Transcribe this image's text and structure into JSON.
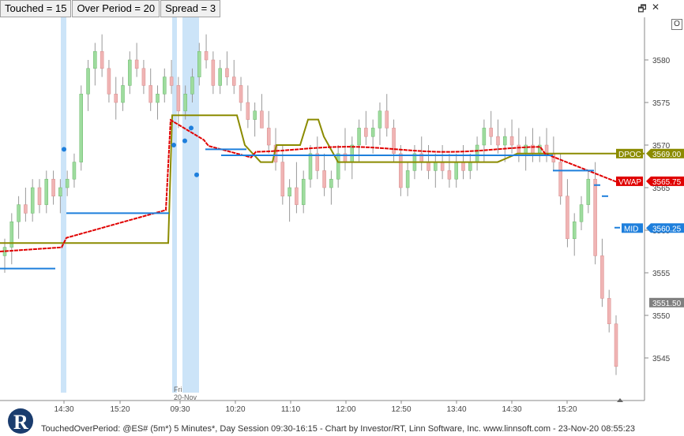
{
  "toolbar": {
    "params": [
      {
        "label": "Touched = 15"
      },
      {
        "label": "Over Period = 20"
      },
      {
        "label": "Spread = 3"
      }
    ]
  },
  "window_buttons": {
    "restore": "🗗",
    "close": "✕",
    "o_button": "O"
  },
  "footer": {
    "text": "TouchedOverPeriod: @ES# (5m*) 5 Minutes*, Day Session 09:30-16:15 - Chart by Investor/RT, Linn Software, Inc. www.linnsoft.com - 23-Nov-20 08:55:23"
  },
  "colors": {
    "vwap": "#e00000",
    "mid": "#1e7fdc",
    "dpoc": "#8b8b00",
    "highlight": "#cce4f8",
    "dot": "#1e7fdc",
    "candle_up": "#9edc9e",
    "candle_down": "#f0b4b4",
    "last_price": "#808080"
  },
  "chart_data": {
    "type": "candlestick",
    "y_ticks": [
      3545,
      3550,
      3555,
      3560,
      3565,
      3570,
      3575,
      3580
    ],
    "ylim": [
      3540,
      3585
    ],
    "x_labels": [
      "14:30",
      "15:20",
      "09:30",
      "10:20",
      "11:10",
      "12:00",
      "12:50",
      "13:40",
      "14:30",
      "15:20"
    ],
    "session_label": [
      "Fri",
      "20-Nov"
    ],
    "candles": [
      [
        3557,
        3559,
        3555,
        3558
      ],
      [
        3558,
        3562,
        3556,
        3561
      ],
      [
        3561,
        3564,
        3559,
        3563
      ],
      [
        3563,
        3565,
        3561,
        3562
      ],
      [
        3562,
        3566,
        3561,
        3565
      ],
      [
        3565,
        3566,
        3562,
        3563
      ],
      [
        3563,
        3567,
        3562,
        3566
      ],
      [
        3566,
        3567,
        3563,
        3564
      ],
      [
        3564,
        3566,
        3562,
        3565
      ],
      [
        3565,
        3567,
        3564,
        3566
      ],
      [
        3566,
        3569,
        3565,
        3568
      ],
      [
        3568,
        3577,
        3567,
        3576
      ],
      [
        3576,
        3580,
        3574,
        3579
      ],
      [
        3579,
        3582,
        3577,
        3581
      ],
      [
        3581,
        3583,
        3578,
        3579
      ],
      [
        3579,
        3580,
        3575,
        3576
      ],
      [
        3576,
        3578,
        3573,
        3575
      ],
      [
        3575,
        3578,
        3574,
        3577
      ],
      [
        3577,
        3581,
        3576,
        3580
      ],
      [
        3580,
        3582,
        3578,
        3579
      ],
      [
        3579,
        3580,
        3576,
        3577
      ],
      [
        3577,
        3579,
        3574,
        3575
      ],
      [
        3575,
        3577,
        3573,
        3576
      ],
      [
        3576,
        3579,
        3575,
        3578
      ],
      [
        3578,
        3580,
        3576,
        3577
      ],
      [
        3577,
        3578,
        3572,
        3574
      ],
      [
        3574,
        3577,
        3573,
        3576
      ],
      [
        3576,
        3579,
        3575,
        3578
      ],
      [
        3578,
        3582,
        3577,
        3581
      ],
      [
        3581,
        3583,
        3579,
        3580
      ],
      [
        3580,
        3581,
        3576,
        3577
      ],
      [
        3577,
        3580,
        3576,
        3579
      ],
      [
        3579,
        3581,
        3577,
        3578
      ],
      [
        3578,
        3580,
        3576,
        3577
      ],
      [
        3577,
        3578,
        3574,
        3575
      ],
      [
        3575,
        3577,
        3572,
        3573
      ],
      [
        3573,
        3575,
        3571,
        3574
      ],
      [
        3574,
        3576,
        3572,
        3572
      ],
      [
        3572,
        3574,
        3569,
        3570
      ],
      [
        3570,
        3572,
        3567,
        3568
      ],
      [
        3568,
        3570,
        3563,
        3564
      ],
      [
        3564,
        3566,
        3561,
        3565
      ],
      [
        3565,
        3568,
        3562,
        3563
      ],
      [
        3563,
        3567,
        3562,
        3566
      ],
      [
        3566,
        3570,
        3565,
        3569
      ],
      [
        3569,
        3571,
        3566,
        3567
      ],
      [
        3567,
        3569,
        3564,
        3565
      ],
      [
        3565,
        3567,
        3563,
        3566
      ],
      [
        3566,
        3570,
        3565,
        3569
      ],
      [
        3569,
        3572,
        3567,
        3568
      ],
      [
        3568,
        3571,
        3566,
        3570
      ],
      [
        3570,
        3573,
        3568,
        3572
      ],
      [
        3572,
        3574,
        3570,
        3571
      ],
      [
        3571,
        3573,
        3569,
        3572
      ],
      [
        3572,
        3575,
        3570,
        3574
      ],
      [
        3574,
        3576,
        3571,
        3572
      ],
      [
        3572,
        3573,
        3568,
        3569
      ],
      [
        3569,
        3570,
        3564,
        3565
      ],
      [
        3565,
        3568,
        3564,
        3567
      ],
      [
        3567,
        3570,
        3566,
        3569
      ],
      [
        3569,
        3571,
        3567,
        3568
      ],
      [
        3568,
        3570,
        3566,
        3567
      ],
      [
        3567,
        3569,
        3565,
        3568
      ],
      [
        3568,
        3570,
        3566,
        3567
      ],
      [
        3567,
        3569,
        3565,
        3566
      ],
      [
        3566,
        3569,
        3565,
        3568
      ],
      [
        3568,
        3570,
        3566,
        3567
      ],
      [
        3567,
        3569,
        3566,
        3568
      ],
      [
        3568,
        3571,
        3567,
        3570
      ],
      [
        3570,
        3573,
        3568,
        3572
      ],
      [
        3572,
        3574,
        3570,
        3571
      ],
      [
        3571,
        3573,
        3569,
        3570
      ],
      [
        3570,
        3572,
        3568,
        3571
      ],
      [
        3571,
        3573,
        3569,
        3570
      ],
      [
        3570,
        3572,
        3568,
        3569
      ],
      [
        3569,
        3571,
        3567,
        3570
      ],
      [
        3570,
        3572,
        3568,
        3569
      ],
      [
        3569,
        3571,
        3568,
        3570
      ],
      [
        3570,
        3572,
        3568,
        3569
      ],
      [
        3569,
        3571,
        3567,
        3568
      ],
      [
        3568,
        3569,
        3563,
        3564
      ],
      [
        3564,
        3566,
        3558,
        3559
      ],
      [
        3559,
        3562,
        3557,
        3561
      ],
      [
        3561,
        3564,
        3560,
        3563
      ],
      [
        3563,
        3567,
        3562,
        3566
      ],
      [
        3566,
        3568,
        3556,
        3557
      ],
      [
        3557,
        3559,
        3551,
        3552
      ],
      [
        3552,
        3553,
        3548,
        3549
      ],
      [
        3549,
        3550,
        3543,
        3544
      ]
    ],
    "series": [
      {
        "name": "DPOC",
        "last_value": 3569.0
      },
      {
        "name": "VWAP",
        "last_value": 3565.75
      },
      {
        "name": "MID",
        "last_value": 3560.25
      }
    ],
    "last_price": 3551.5
  }
}
